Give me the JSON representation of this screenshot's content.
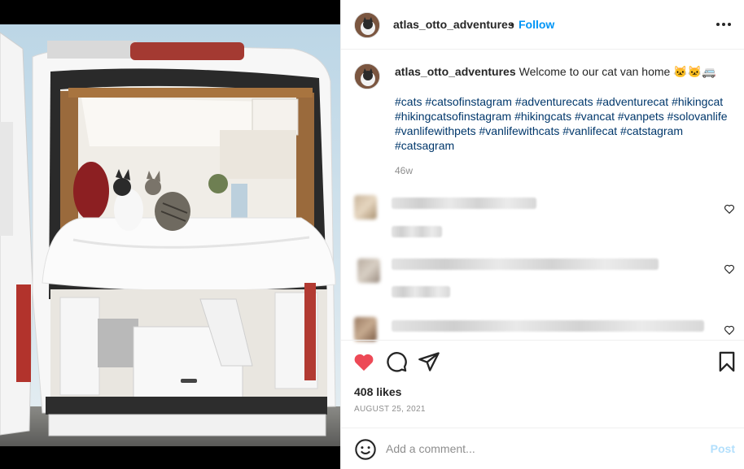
{
  "post": {
    "username": "atlas_otto_adventures",
    "follow_label": "Follow",
    "separator": "•",
    "caption_text": "Welcome to our cat van home 🐱🐱🚐",
    "hashtags": "#cats #catsofinstagram #adventurecats #adventurecat #hikingcat #hikingcatsofinstagram #hikingcats #vancat #vanpets #solovanlife #vanlifewithpets #vanlifewithcats #vanlifecat #catstagram #catsagram",
    "age": "46w",
    "likes": "408 likes",
    "date": "AUGUST 25, 2021"
  },
  "comment_box": {
    "placeholder": "Add a comment...",
    "post_label": "Post"
  },
  "icons": {
    "like": "heart-filled-icon",
    "comment": "comment-bubble-icon",
    "share": "paper-plane-icon",
    "save": "bookmark-icon",
    "emoji": "emoji-smile-icon",
    "more": "more-dots-icon"
  },
  "colors": {
    "like_red": "#ed4956",
    "link_blue": "#0095f6",
    "hashtag_blue": "#00376b",
    "muted": "#8e8e8e"
  }
}
